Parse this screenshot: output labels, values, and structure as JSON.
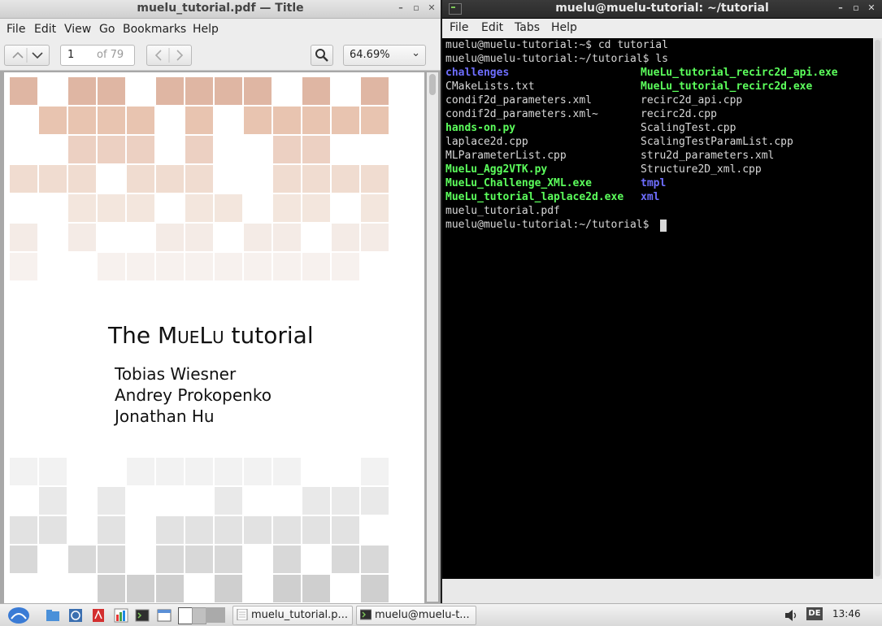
{
  "pdf_viewer": {
    "title": "muelu_tutorial.pdf — Title",
    "menu": [
      "File",
      "Edit",
      "View",
      "Go",
      "Bookmarks",
      "Help"
    ],
    "page_number": "1",
    "page_of": "of 79",
    "zoom": "64.69%",
    "document": {
      "title_prefix": "The ",
      "title_mueLu": "MueLu",
      "title_suffix": " tutorial",
      "authors": [
        "Tobias Wiesner",
        "Andrey Prokopenko",
        "Jonathan Hu"
      ]
    }
  },
  "terminal": {
    "title": "muelu@muelu-tutorial: ~/tutorial",
    "menu": [
      "File",
      "Edit",
      "Tabs",
      "Help"
    ],
    "lines": [
      "muelu@muelu-tutorial:~$ cd tutorial",
      "muelu@muelu-tutorial:~/tutorial$ ls"
    ],
    "ls_left": [
      {
        "name": "challenges",
        "kind": "dir"
      },
      {
        "name": "CMakeLists.txt",
        "kind": "file"
      },
      {
        "name": "condif2d_parameters.xml",
        "kind": "file"
      },
      {
        "name": "condif2d_parameters.xml~",
        "kind": "file"
      },
      {
        "name": "hands-on.py",
        "kind": "exec"
      },
      {
        "name": "laplace2d.cpp",
        "kind": "file"
      },
      {
        "name": "MLParameterList.cpp",
        "kind": "file"
      },
      {
        "name": "MueLu_Agg2VTK.py",
        "kind": "exec"
      },
      {
        "name": "MueLu_Challenge_XML.exe",
        "kind": "exec"
      },
      {
        "name": "MueLu_tutorial_laplace2d.exe",
        "kind": "exec"
      },
      {
        "name": "muelu_tutorial.pdf",
        "kind": "file"
      }
    ],
    "ls_right": [
      {
        "name": "MueLu_tutorial_recirc2d_api.exe",
        "kind": "exec"
      },
      {
        "name": "MueLu_tutorial_recirc2d.exe",
        "kind": "exec"
      },
      {
        "name": "recirc2d_api.cpp",
        "kind": "file"
      },
      {
        "name": "recirc2d.cpp",
        "kind": "file"
      },
      {
        "name": "ScalingTest.cpp",
        "kind": "file"
      },
      {
        "name": "ScalingTestParamList.cpp",
        "kind": "file"
      },
      {
        "name": "stru2d_parameters.xml",
        "kind": "file"
      },
      {
        "name": "Structure2D_xml.cpp",
        "kind": "file"
      },
      {
        "name": "tmpl",
        "kind": "dir"
      },
      {
        "name": "xml",
        "kind": "dir"
      }
    ],
    "prompt": "muelu@muelu-tutorial:~/tutorial$ ",
    "colors": {
      "dir": "#6e6eff",
      "exec": "#5cff5c",
      "file": "#d8d8d8"
    }
  },
  "taskbar": {
    "tasks": [
      {
        "label": "muelu_tutorial.p..."
      },
      {
        "label": "muelu@muelu-t..."
      }
    ],
    "keyboard_layout": "DE",
    "clock": "13:46"
  }
}
